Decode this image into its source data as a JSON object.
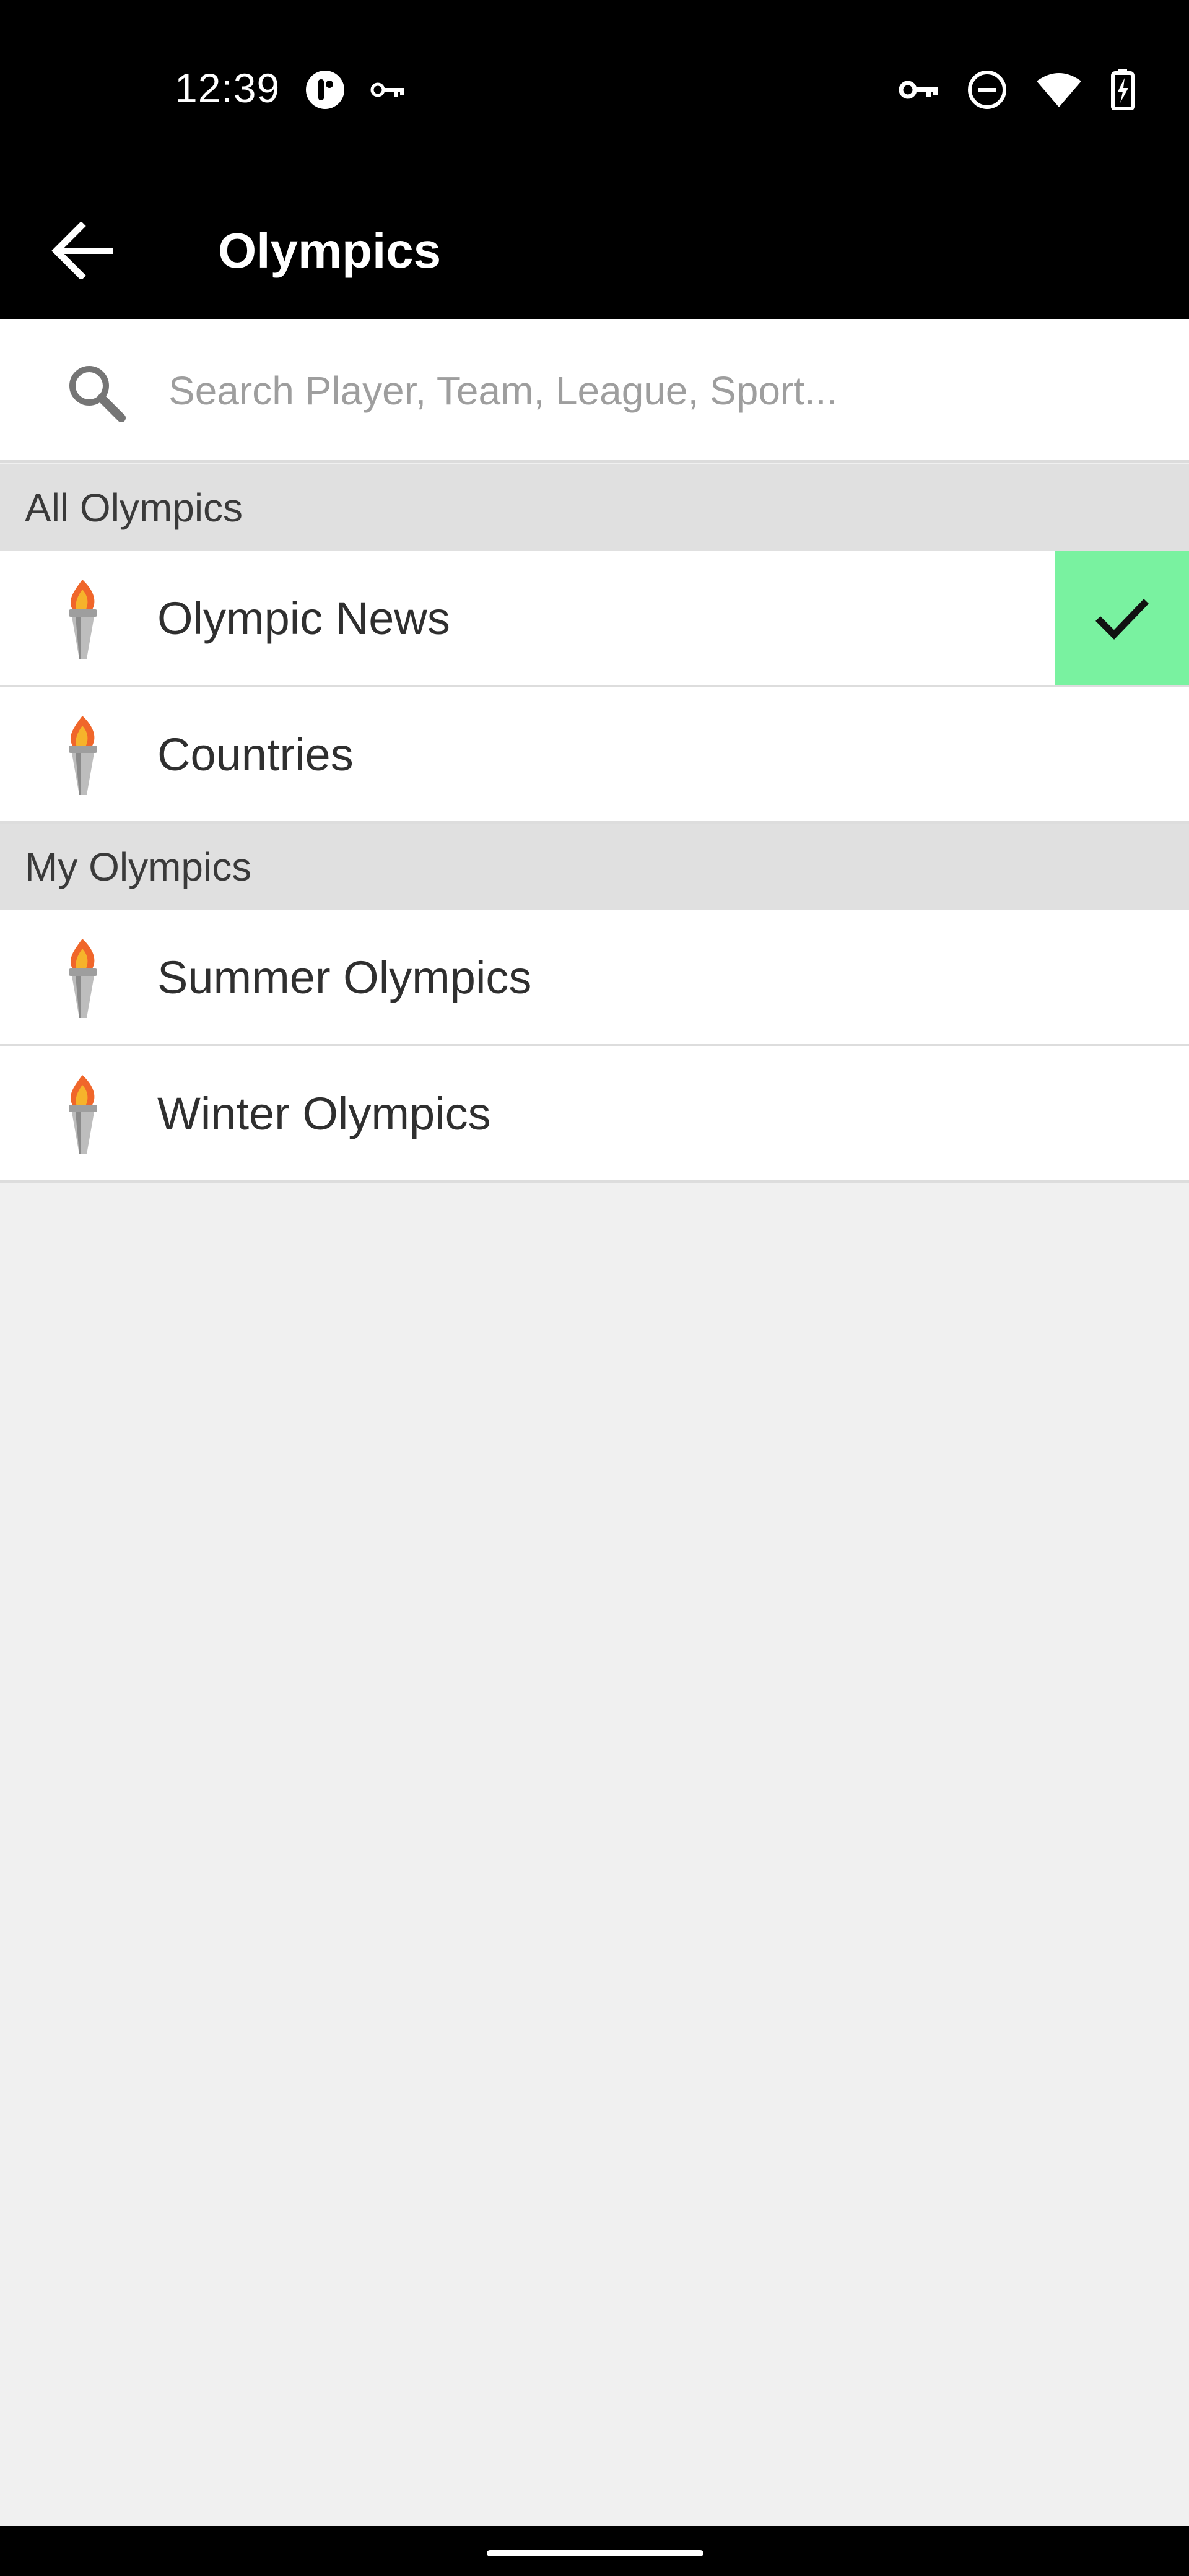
{
  "status_bar": {
    "time": "12:39",
    "left_icons": [
      "notification-app-icon",
      "vpn-key-icon"
    ],
    "right_icons": [
      "vpn-key-icon",
      "do-not-disturb-icon",
      "wifi-icon",
      "battery-charging-icon"
    ]
  },
  "app_bar": {
    "back_icon": "arrow-back-icon",
    "title": "Olympics"
  },
  "search": {
    "icon": "search-icon",
    "placeholder": "Search Player, Team, League, Sport..."
  },
  "sections": [
    {
      "header": "All Olympics",
      "items": [
        {
          "label": "Olympic News",
          "icon": "torch-icon",
          "selected": true
        },
        {
          "label": "Countries",
          "icon": "torch-icon",
          "selected": false
        }
      ]
    },
    {
      "header": "My Olympics",
      "items": [
        {
          "label": "Summer Olympics",
          "icon": "torch-icon",
          "selected": false
        },
        {
          "label": "Winter Olympics",
          "icon": "torch-icon",
          "selected": false
        }
      ]
    }
  ],
  "colors": {
    "selected_accent": "#79f2a0",
    "bar_background": "#000000",
    "section_header_background": "#e0e0e0",
    "page_background": "#f0f0f0"
  }
}
